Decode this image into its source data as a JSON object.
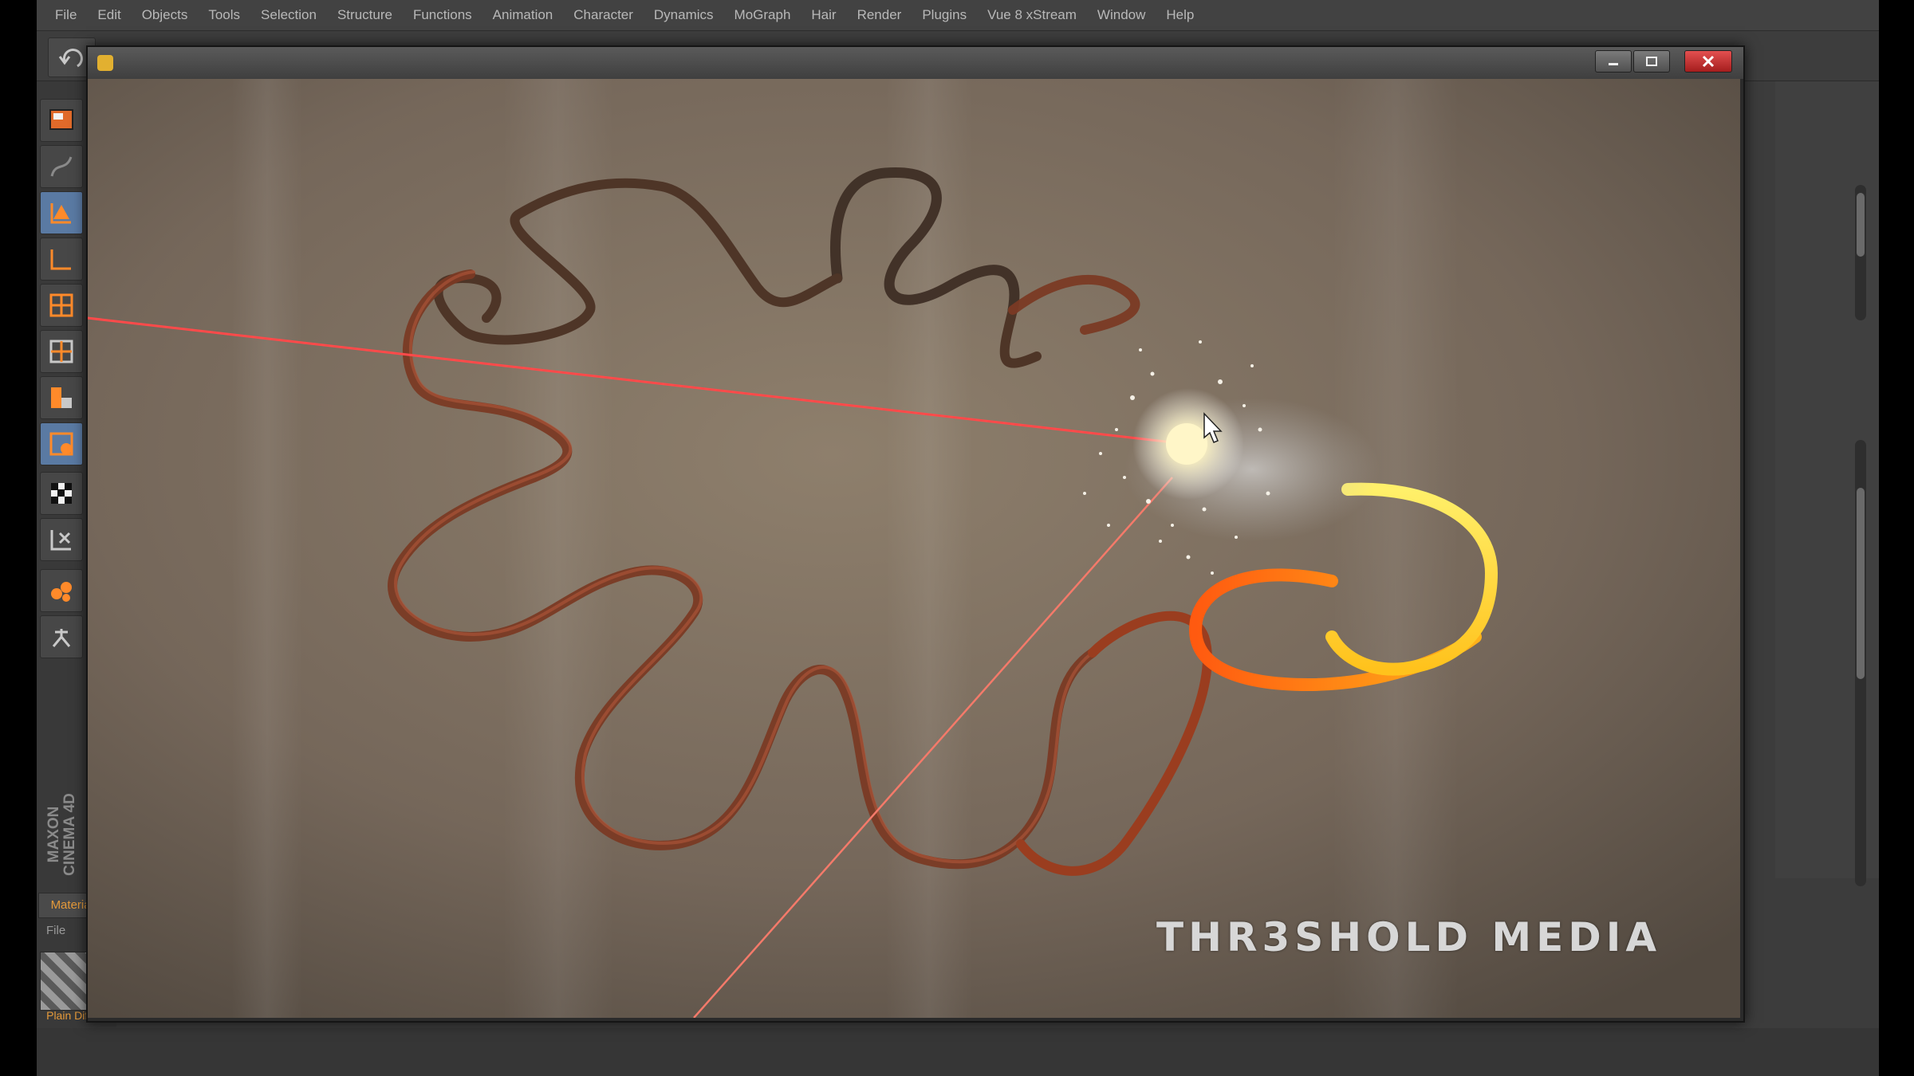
{
  "app": {
    "menu": [
      "File",
      "Edit",
      "Objects",
      "Tools",
      "Selection",
      "Structure",
      "Functions",
      "Animation",
      "Character",
      "Dynamics",
      "MoGraph",
      "Hair",
      "Render",
      "Plugins",
      "Vue 8 xStream",
      "Window",
      "Help"
    ],
    "brand_line1": "MAXON",
    "brand_line2": "CINEMA 4D"
  },
  "materials": {
    "tab_label": "Materials",
    "file_label": "File",
    "material_name": "Plain Diff"
  },
  "viewer": {
    "watermark": "THR3SHOLD MEDIA"
  },
  "tools": [
    {
      "icon": "viewport-layout-icon",
      "active": false
    },
    {
      "icon": "curve-pen-icon",
      "active": false
    },
    {
      "icon": "move-axis-icon",
      "active": true
    },
    {
      "icon": "scale-axis-icon",
      "active": false
    },
    {
      "icon": "object-grid-icon",
      "active": false
    },
    {
      "icon": "polygon-grid-icon",
      "active": false
    },
    {
      "icon": "point-grid-icon",
      "active": false
    },
    {
      "icon": "edge-grid-icon",
      "active": true
    },
    {
      "icon": "checker-icon",
      "active": false
    },
    {
      "icon": "snap-icon",
      "active": false
    },
    {
      "icon": "sculpt-icon",
      "active": false
    },
    {
      "icon": "bone-icon",
      "active": false
    }
  ]
}
